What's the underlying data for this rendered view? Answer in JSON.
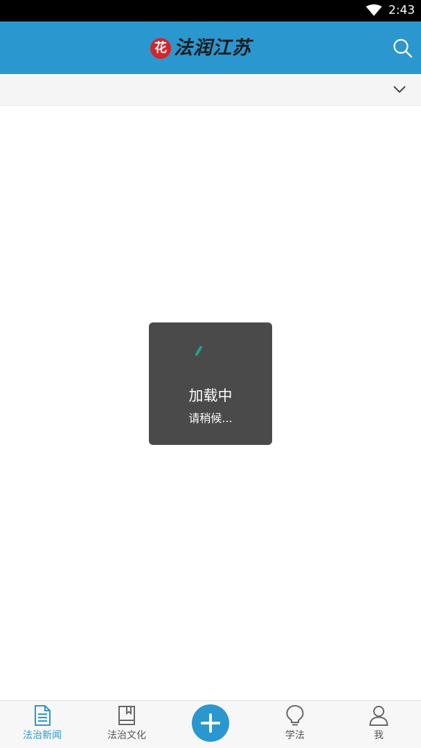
{
  "status_bar": {
    "time": "2:43",
    "icons": [
      "wifi-icon"
    ]
  },
  "header": {
    "logo_mark": "花",
    "logo_text": "法润江苏",
    "search_icon": "search-icon",
    "background": "#2b97cf"
  },
  "category_bar": {
    "expand_icon": "chevron-down-icon"
  },
  "loading": {
    "title": "加载中",
    "subtitle": "请稍候...",
    "spinner_color": "#1aa58a"
  },
  "bottom_nav": {
    "items": [
      {
        "label": "法治新闻",
        "icon": "document-icon",
        "active": true
      },
      {
        "label": "法治文化",
        "icon": "book-icon",
        "active": false
      },
      {
        "label": "",
        "icon": "plus-icon",
        "active": false
      },
      {
        "label": "学法",
        "icon": "lightbulb-icon",
        "active": false
      },
      {
        "label": "我",
        "icon": "user-icon",
        "active": false
      }
    ],
    "active_color": "#2b97cf"
  }
}
